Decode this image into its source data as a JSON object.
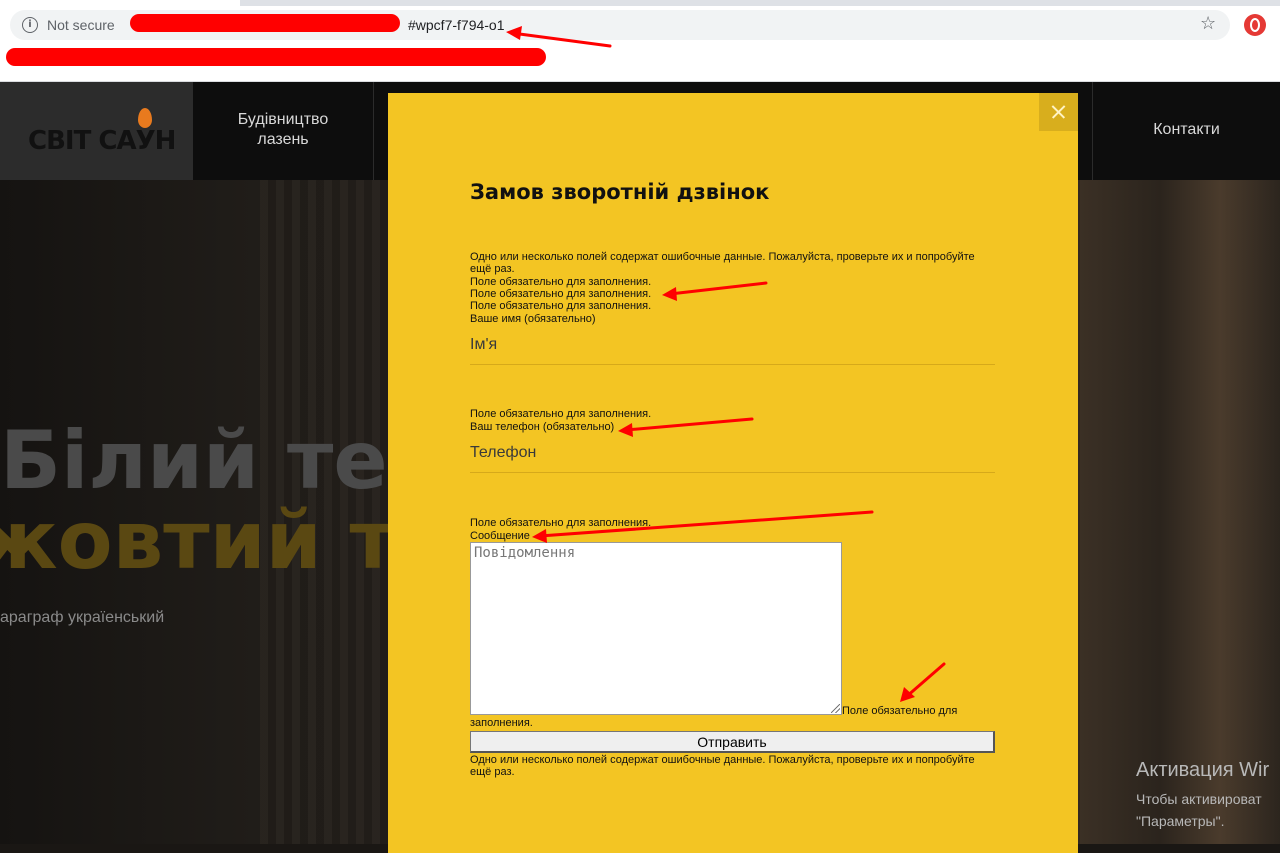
{
  "browser": {
    "security_label": "Not secure",
    "url_separator": "|",
    "url_visible": "#wpcf7-f794-o1"
  },
  "site": {
    "logo": "СВІТ САУН",
    "nav": [
      "Будівництво\nлазень",
      "Контакти"
    ]
  },
  "hero": {
    "title_line1": "Білий тек",
    "title_line2": "жовтий т",
    "paragraph": "араграф україeнський"
  },
  "modal": {
    "title": "Замов зворотній дзвінок",
    "error_summary_top": "Одно или несколько полей содержат ошибочные данные. Пожалуйста, проверьте их и попробуйте ещё раз.",
    "required_msg": "Поле обязательно для заполнения.",
    "name_label": "Ваше имя (обязательно)",
    "name_placeholder": "Ім'я",
    "phone_label": "Ваш телефон (обязательно)",
    "phone_placeholder": "Телефон",
    "message_label": "Сообщение",
    "message_placeholder": "Повідомлення",
    "required_msg_split_a": "Поле обязательно для",
    "required_msg_split_b": "заполнения.",
    "submit_label": "Отправить",
    "error_summary_bottom": "Одно или несколько полей содержат ошибочные данные. Пожалуйста, проверьте их и попробуйте ещё раз."
  },
  "windows_activation": {
    "title": "Активация Wir",
    "line1": "Чтобы активироват",
    "line2": "\"Параметры\"."
  },
  "colors": {
    "modal_bg": "#f3c523",
    "annotation_red": "#ff0000"
  }
}
